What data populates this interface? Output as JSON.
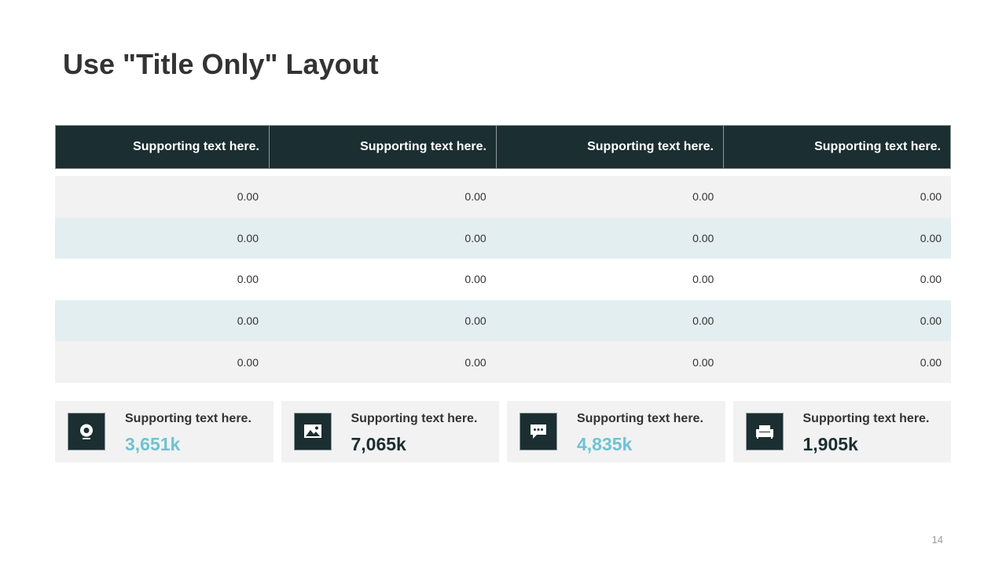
{
  "slide": {
    "title": "Use \"Title Only\" Layout",
    "page_number": "14"
  },
  "table": {
    "headers": [
      "Supporting text here.",
      "Supporting text here.",
      "Supporting text here.",
      "Supporting text here."
    ],
    "rows": [
      {
        "bg": "#f2f2f2",
        "cells": [
          "0.00",
          "0.00",
          "0.00",
          "0.00"
        ]
      },
      {
        "bg": "#e3eef0",
        "cells": [
          "0.00",
          "0.00",
          "0.00",
          "0.00"
        ]
      },
      {
        "bg": "#ffffff",
        "cells": [
          "0.00",
          "0.00",
          "0.00",
          "0.00"
        ]
      },
      {
        "bg": "#e3eef0",
        "cells": [
          "0.00",
          "0.00",
          "0.00",
          "0.00"
        ]
      },
      {
        "bg": "#f2f2f2",
        "cells": [
          "0.00",
          "0.00",
          "0.00",
          "0.00"
        ]
      }
    ]
  },
  "stats": [
    {
      "icon": "webcam-icon",
      "label": "Supporting text here.",
      "value": "3,651k",
      "color": "#6fc3d3"
    },
    {
      "icon": "image-icon",
      "label": "Supporting text here.",
      "value": "7,065k",
      "color": "#1b2e31"
    },
    {
      "icon": "chat-icon",
      "label": "Supporting text here.",
      "value": "4,835k",
      "color": "#6fc3d3"
    },
    {
      "icon": "sofa-icon",
      "label": "Supporting text here.",
      "value": "1,905k",
      "color": "#1b2e31"
    }
  ],
  "colors": {
    "dark": "#1b2e31",
    "accent": "#6fc3d3"
  }
}
